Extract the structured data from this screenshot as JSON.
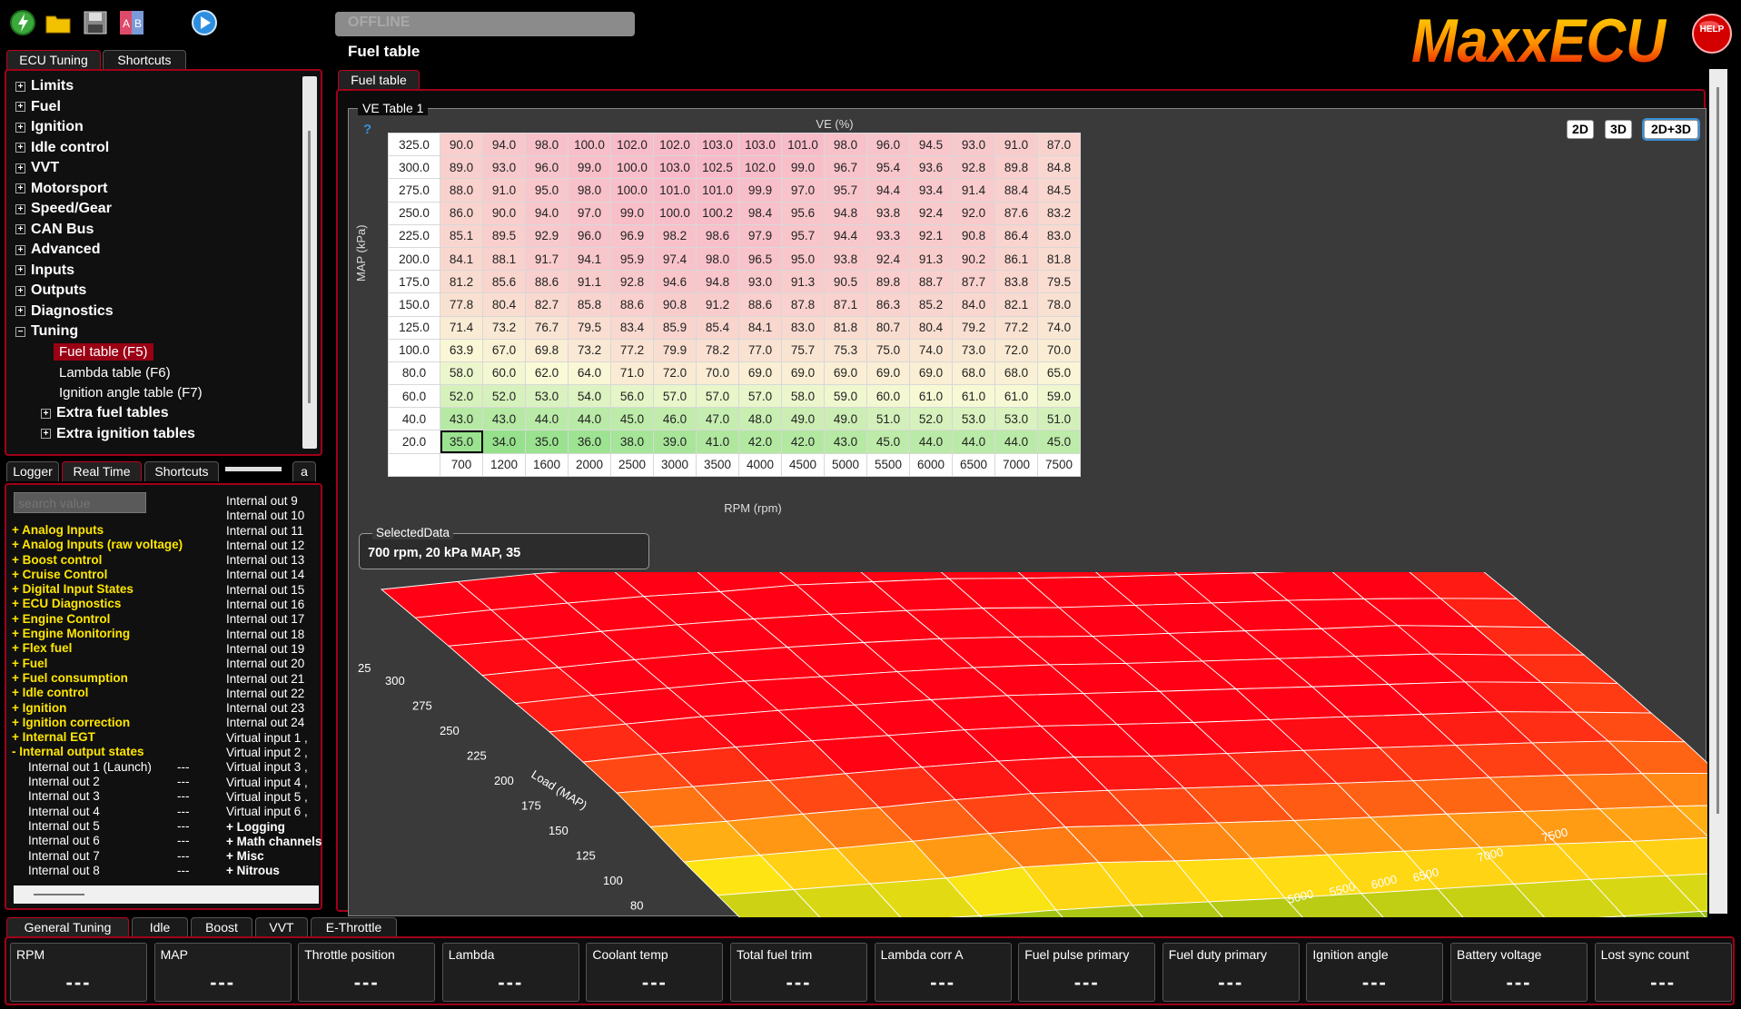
{
  "toolbar": {
    "status": "OFFLINE"
  },
  "page_title": "Fuel table",
  "brand": {
    "logo_text": "MaxxECU",
    "help_text": "HELP"
  },
  "left_tabs": [
    "ECU Tuning",
    "Shortcuts"
  ],
  "tree": {
    "items": [
      "Limits",
      "Fuel",
      "Ignition",
      "Idle control",
      "VVT",
      "Motorsport",
      "Speed/Gear",
      "CAN Bus",
      "Advanced",
      "Inputs",
      "Outputs",
      "Diagnostics",
      "Tuning"
    ],
    "tuning_children": [
      "Fuel table (F5)",
      "Lambda table (F6)",
      "Ignition angle table (F7)"
    ],
    "tuning_groups": [
      "Extra fuel tables",
      "Extra ignition tables"
    ]
  },
  "rt_tabs": [
    "Logger",
    "Real Time",
    "Shortcuts",
    "a"
  ],
  "rt": {
    "search_placeholder": "search value",
    "categories": [
      "+ Analog Inputs",
      "+ Analog Inputs (raw voltage)",
      "+ Boost control",
      "+ Cruise Control",
      "+ Digital Input States",
      "+ ECU Diagnostics",
      "+ Engine Control",
      "+ Engine Monitoring",
      "+ Flex fuel",
      "+ Fuel",
      "+ Fuel consumption",
      "+ Idle control",
      "+ Ignition",
      "+ Ignition correction",
      "+ Internal EGT",
      "- Internal output states"
    ],
    "internal_outs": [
      {
        "name": "Internal out 1 (Launch)",
        "value": "---"
      },
      {
        "name": "Internal out 2",
        "value": "---"
      },
      {
        "name": "Internal out 3",
        "value": "---"
      },
      {
        "name": "Internal out 4",
        "value": "---"
      },
      {
        "name": "Internal out 5",
        "value": "---"
      },
      {
        "name": "Internal out 6",
        "value": "---"
      },
      {
        "name": "Internal out 7",
        "value": "---"
      },
      {
        "name": "Internal out 8",
        "value": "---"
      }
    ],
    "col2_items": [
      "Internal out 9",
      "Internal out 10",
      "Internal out 11",
      "Internal out 12",
      "Internal out 13",
      "Internal out 14",
      "Internal out 15",
      "Internal out 16",
      "Internal out 17",
      "Internal out 18",
      "Internal out 19",
      "Internal out 20",
      "Internal out 21",
      "Internal out 22",
      "Internal out 23",
      "Internal out 24",
      "Virtual input 1 ,",
      "Virtual input 2 ,",
      "Virtual input 3 ,",
      "Virtual input 4 ,",
      "Virtual input 5 ,",
      "Virtual input 6 ,"
    ],
    "col2_categories": [
      "+ Logging",
      "+ Math channels",
      "+ Misc",
      "+ Nitrous"
    ]
  },
  "content_tab": "Fuel table",
  "ve_group_title": "VE Table 1",
  "view_buttons": [
    "2D",
    "3D",
    "2D+3D"
  ],
  "help_q": "?",
  "ve": {
    "title": "VE (%)",
    "ylabel": "MAP (kPa)",
    "xlabel": "RPM (rpm)",
    "rows": [
      "325.0",
      "300.0",
      "275.0",
      "250.0",
      "225.0",
      "200.0",
      "175.0",
      "150.0",
      "125.0",
      "100.0",
      "80.0",
      "60.0",
      "40.0",
      "20.0"
    ],
    "cols": [
      "700",
      "1200",
      "1600",
      "2000",
      "2500",
      "3000",
      "3500",
      "4000",
      "4500",
      "5000",
      "5500",
      "6000",
      "6500",
      "7000",
      "7500"
    ],
    "values": [
      [
        90.0,
        94.0,
        98.0,
        100.0,
        102.0,
        102.0,
        103.0,
        103.0,
        101.0,
        98.0,
        96.0,
        94.5,
        93.0,
        91.0,
        87.0
      ],
      [
        89.0,
        93.0,
        96.0,
        99.0,
        100.0,
        103.0,
        102.5,
        102.0,
        99.0,
        96.7,
        95.4,
        93.6,
        92.8,
        89.8,
        84.8
      ],
      [
        88.0,
        91.0,
        95.0,
        98.0,
        100.0,
        101.0,
        101.0,
        99.9,
        97.0,
        95.7,
        94.4,
        93.4,
        91.4,
        88.4,
        84.5
      ],
      [
        86.0,
        90.0,
        94.0,
        97.0,
        99.0,
        100.0,
        100.2,
        98.4,
        95.6,
        94.8,
        93.8,
        92.4,
        92.0,
        87.6,
        83.2
      ],
      [
        85.1,
        89.5,
        92.9,
        96.0,
        96.9,
        98.2,
        98.6,
        97.9,
        95.7,
        94.4,
        93.3,
        92.1,
        90.8,
        86.4,
        83.0
      ],
      [
        84.1,
        88.1,
        91.7,
        94.1,
        95.9,
        97.4,
        98.0,
        96.5,
        95.0,
        93.8,
        92.4,
        91.3,
        90.2,
        86.1,
        81.8
      ],
      [
        81.2,
        85.6,
        88.6,
        91.1,
        92.8,
        94.6,
        94.8,
        93.0,
        91.3,
        90.5,
        89.8,
        88.7,
        87.7,
        83.8,
        79.5
      ],
      [
        77.8,
        80.4,
        82.7,
        85.8,
        88.6,
        90.8,
        91.2,
        88.6,
        87.8,
        87.1,
        86.3,
        85.2,
        84.0,
        82.1,
        78.0
      ],
      [
        71.4,
        73.2,
        76.7,
        79.5,
        83.4,
        85.9,
        85.4,
        84.1,
        83.0,
        81.8,
        80.7,
        80.4,
        79.2,
        77.2,
        74.0
      ],
      [
        63.9,
        67.0,
        69.8,
        73.2,
        77.2,
        79.9,
        78.2,
        77.0,
        75.7,
        75.3,
        75.0,
        74.0,
        73.0,
        72.0,
        70.0
      ],
      [
        58.0,
        60.0,
        62.0,
        64.0,
        71.0,
        72.0,
        70.0,
        69.0,
        69.0,
        69.0,
        69.0,
        69.0,
        68.0,
        68.0,
        65.0
      ],
      [
        52.0,
        52.0,
        53.0,
        54.0,
        56.0,
        57.0,
        57.0,
        57.0,
        58.0,
        59.0,
        60.0,
        61.0,
        61.0,
        61.0,
        59.0
      ],
      [
        43.0,
        43.0,
        44.0,
        44.0,
        45.0,
        46.0,
        47.0,
        48.0,
        49.0,
        49.0,
        51.0,
        52.0,
        53.0,
        53.0,
        51.0
      ],
      [
        35.0,
        34.0,
        35.0,
        36.0,
        38.0,
        39.0,
        41.0,
        42.0,
        42.0,
        43.0,
        45.0,
        44.0,
        44.0,
        44.0,
        45.0
      ]
    ]
  },
  "selected_data": {
    "title": "SelectedData",
    "value": "700 rpm, 20 kPa MAP, 35"
  },
  "surface": {
    "z_label": "25",
    "load_ticks": [
      "300",
      "275",
      "250",
      "225",
      "200",
      "175",
      "150",
      "125",
      "100",
      "80"
    ],
    "load_label": "Load (MAP)",
    "rpm_ticks": [
      "5000",
      "5500",
      "6000",
      "6500",
      "7000",
      "7500"
    ]
  },
  "bottom_tabs": [
    "General Tuning",
    "Idle",
    "Boost",
    "VVT",
    "E-Throttle"
  ],
  "gauges": [
    {
      "label": "RPM",
      "value": "---"
    },
    {
      "label": "MAP",
      "value": "---"
    },
    {
      "label": "Throttle position",
      "value": "---"
    },
    {
      "label": "Lambda",
      "value": "---"
    },
    {
      "label": "Coolant temp",
      "value": "---"
    },
    {
      "label": "Total fuel trim",
      "value": "---"
    },
    {
      "label": "Lambda corr A",
      "value": "---"
    },
    {
      "label": "Fuel pulse primary",
      "value": "---"
    },
    {
      "label": "Fuel duty primary",
      "value": "---"
    },
    {
      "label": "Ignition angle",
      "value": "---"
    },
    {
      "label": "Battery voltage",
      "value": "---"
    },
    {
      "label": "Lost sync count",
      "value": "---"
    }
  ]
}
